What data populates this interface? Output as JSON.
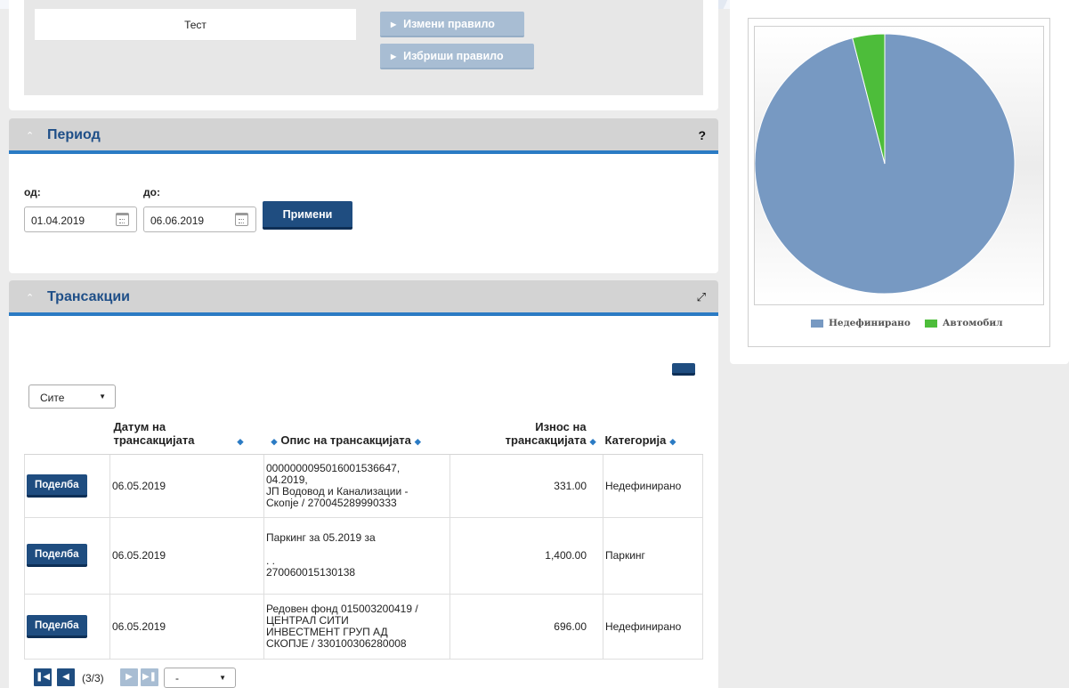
{
  "rules": {
    "rule_name": "Тест",
    "edit_rule": "Измени правило",
    "delete_rule": "Избриши правило"
  },
  "period": {
    "title": "Период",
    "help": "?",
    "from_label": "од:",
    "from_value": "01.04.2019",
    "to_label": "до:",
    "to_value": "06.06.2019",
    "apply": "Примени"
  },
  "transactions": {
    "title": "Трансакции",
    "filter_value": "Сите",
    "headers": {
      "date": "Датум на трансакцијата",
      "description": "Опис на трансакцијата",
      "amount": "Износ на трансакцијата",
      "category": "Категорија"
    },
    "split_label": "Поделба",
    "rows": [
      {
        "date": "06.05.2019",
        "description": "0000000095016001536647,\n04.2019,\nЈП Водовод и Канализации -\nСкопје / 270045289990333",
        "amount": "331.00",
        "category": "Недефинирано"
      },
      {
        "date": "06.05.2019",
        "description": "Паркинг за 05.2019 за\n\n. .\n270060015130138",
        "amount": "1,400.00",
        "category": "Паркинг"
      },
      {
        "date": "06.05.2019",
        "description": "Редовен фонд 015003200419 /\nЦЕНТРАЛ СИТИ\nИНВЕСТМЕНТ ГРУП АД\nСКОПЈЕ / 330100306280008",
        "amount": "696.00",
        "category": "Недефинирано"
      }
    ],
    "pager": {
      "page_info": "(3/3)",
      "page_size_value": "-"
    }
  },
  "chart_data": {
    "type": "pie",
    "labels": [
      "Недефинирано",
      "Автомобил"
    ],
    "values": [
      96,
      4
    ],
    "colors": [
      "#7799c2",
      "#4dbd3a"
    ],
    "legend_position": "bottom"
  },
  "icons": {
    "collapse": "chevron-up-icon",
    "expand": "expand-arrows-icon",
    "calendar": "calendar-icon"
  }
}
